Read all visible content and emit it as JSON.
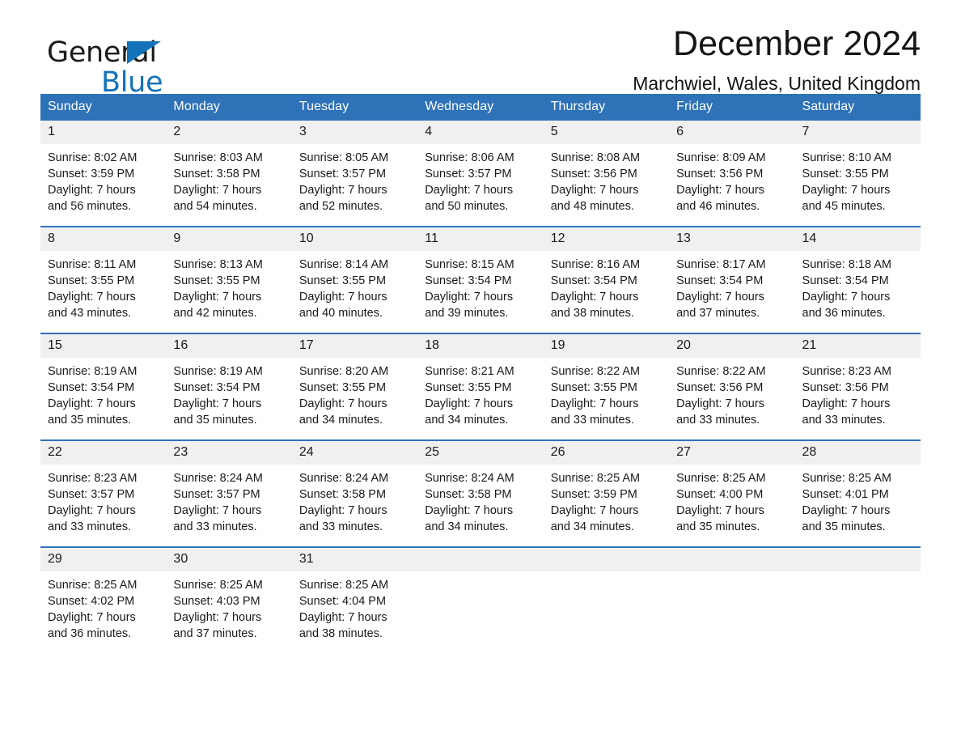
{
  "brand": {
    "name_part1": "General",
    "name_part2": "Blue",
    "flag_icon": "triangle-flag-icon",
    "accent_color": "#1372ba"
  },
  "header": {
    "title": "December 2024",
    "subtitle": "Marchwiel, Wales, United Kingdom"
  },
  "theme": {
    "header_blue": "#2e72b8",
    "daynum_band": "#f0f0f0",
    "text": "#1a1a1a"
  },
  "weekday_headers": [
    "Sunday",
    "Monday",
    "Tuesday",
    "Wednesday",
    "Thursday",
    "Friday",
    "Saturday"
  ],
  "weeks": [
    {
      "days": [
        {
          "num": "1",
          "sunrise": "Sunrise: 8:02 AM",
          "sunset": "Sunset: 3:59 PM",
          "daylight_line1": "Daylight: 7 hours",
          "daylight_line2": "and 56 minutes."
        },
        {
          "num": "2",
          "sunrise": "Sunrise: 8:03 AM",
          "sunset": "Sunset: 3:58 PM",
          "daylight_line1": "Daylight: 7 hours",
          "daylight_line2": "and 54 minutes."
        },
        {
          "num": "3",
          "sunrise": "Sunrise: 8:05 AM",
          "sunset": "Sunset: 3:57 PM",
          "daylight_line1": "Daylight: 7 hours",
          "daylight_line2": "and 52 minutes."
        },
        {
          "num": "4",
          "sunrise": "Sunrise: 8:06 AM",
          "sunset": "Sunset: 3:57 PM",
          "daylight_line1": "Daylight: 7 hours",
          "daylight_line2": "and 50 minutes."
        },
        {
          "num": "5",
          "sunrise": "Sunrise: 8:08 AM",
          "sunset": "Sunset: 3:56 PM",
          "daylight_line1": "Daylight: 7 hours",
          "daylight_line2": "and 48 minutes."
        },
        {
          "num": "6",
          "sunrise": "Sunrise: 8:09 AM",
          "sunset": "Sunset: 3:56 PM",
          "daylight_line1": "Daylight: 7 hours",
          "daylight_line2": "and 46 minutes."
        },
        {
          "num": "7",
          "sunrise": "Sunrise: 8:10 AM",
          "sunset": "Sunset: 3:55 PM",
          "daylight_line1": "Daylight: 7 hours",
          "daylight_line2": "and 45 minutes."
        }
      ]
    },
    {
      "days": [
        {
          "num": "8",
          "sunrise": "Sunrise: 8:11 AM",
          "sunset": "Sunset: 3:55 PM",
          "daylight_line1": "Daylight: 7 hours",
          "daylight_line2": "and 43 minutes."
        },
        {
          "num": "9",
          "sunrise": "Sunrise: 8:13 AM",
          "sunset": "Sunset: 3:55 PM",
          "daylight_line1": "Daylight: 7 hours",
          "daylight_line2": "and 42 minutes."
        },
        {
          "num": "10",
          "sunrise": "Sunrise: 8:14 AM",
          "sunset": "Sunset: 3:55 PM",
          "daylight_line1": "Daylight: 7 hours",
          "daylight_line2": "and 40 minutes."
        },
        {
          "num": "11",
          "sunrise": "Sunrise: 8:15 AM",
          "sunset": "Sunset: 3:54 PM",
          "daylight_line1": "Daylight: 7 hours",
          "daylight_line2": "and 39 minutes."
        },
        {
          "num": "12",
          "sunrise": "Sunrise: 8:16 AM",
          "sunset": "Sunset: 3:54 PM",
          "daylight_line1": "Daylight: 7 hours",
          "daylight_line2": "and 38 minutes."
        },
        {
          "num": "13",
          "sunrise": "Sunrise: 8:17 AM",
          "sunset": "Sunset: 3:54 PM",
          "daylight_line1": "Daylight: 7 hours",
          "daylight_line2": "and 37 minutes."
        },
        {
          "num": "14",
          "sunrise": "Sunrise: 8:18 AM",
          "sunset": "Sunset: 3:54 PM",
          "daylight_line1": "Daylight: 7 hours",
          "daylight_line2": "and 36 minutes."
        }
      ]
    },
    {
      "days": [
        {
          "num": "15",
          "sunrise": "Sunrise: 8:19 AM",
          "sunset": "Sunset: 3:54 PM",
          "daylight_line1": "Daylight: 7 hours",
          "daylight_line2": "and 35 minutes."
        },
        {
          "num": "16",
          "sunrise": "Sunrise: 8:19 AM",
          "sunset": "Sunset: 3:54 PM",
          "daylight_line1": "Daylight: 7 hours",
          "daylight_line2": "and 35 minutes."
        },
        {
          "num": "17",
          "sunrise": "Sunrise: 8:20 AM",
          "sunset": "Sunset: 3:55 PM",
          "daylight_line1": "Daylight: 7 hours",
          "daylight_line2": "and 34 minutes."
        },
        {
          "num": "18",
          "sunrise": "Sunrise: 8:21 AM",
          "sunset": "Sunset: 3:55 PM",
          "daylight_line1": "Daylight: 7 hours",
          "daylight_line2": "and 34 minutes."
        },
        {
          "num": "19",
          "sunrise": "Sunrise: 8:22 AM",
          "sunset": "Sunset: 3:55 PM",
          "daylight_line1": "Daylight: 7 hours",
          "daylight_line2": "and 33 minutes."
        },
        {
          "num": "20",
          "sunrise": "Sunrise: 8:22 AM",
          "sunset": "Sunset: 3:56 PM",
          "daylight_line1": "Daylight: 7 hours",
          "daylight_line2": "and 33 minutes."
        },
        {
          "num": "21",
          "sunrise": "Sunrise: 8:23 AM",
          "sunset": "Sunset: 3:56 PM",
          "daylight_line1": "Daylight: 7 hours",
          "daylight_line2": "and 33 minutes."
        }
      ]
    },
    {
      "days": [
        {
          "num": "22",
          "sunrise": "Sunrise: 8:23 AM",
          "sunset": "Sunset: 3:57 PM",
          "daylight_line1": "Daylight: 7 hours",
          "daylight_line2": "and 33 minutes."
        },
        {
          "num": "23",
          "sunrise": "Sunrise: 8:24 AM",
          "sunset": "Sunset: 3:57 PM",
          "daylight_line1": "Daylight: 7 hours",
          "daylight_line2": "and 33 minutes."
        },
        {
          "num": "24",
          "sunrise": "Sunrise: 8:24 AM",
          "sunset": "Sunset: 3:58 PM",
          "daylight_line1": "Daylight: 7 hours",
          "daylight_line2": "and 33 minutes."
        },
        {
          "num": "25",
          "sunrise": "Sunrise: 8:24 AM",
          "sunset": "Sunset: 3:58 PM",
          "daylight_line1": "Daylight: 7 hours",
          "daylight_line2": "and 34 minutes."
        },
        {
          "num": "26",
          "sunrise": "Sunrise: 8:25 AM",
          "sunset": "Sunset: 3:59 PM",
          "daylight_line1": "Daylight: 7 hours",
          "daylight_line2": "and 34 minutes."
        },
        {
          "num": "27",
          "sunrise": "Sunrise: 8:25 AM",
          "sunset": "Sunset: 4:00 PM",
          "daylight_line1": "Daylight: 7 hours",
          "daylight_line2": "and 35 minutes."
        },
        {
          "num": "28",
          "sunrise": "Sunrise: 8:25 AM",
          "sunset": "Sunset: 4:01 PM",
          "daylight_line1": "Daylight: 7 hours",
          "daylight_line2": "and 35 minutes."
        }
      ]
    },
    {
      "days": [
        {
          "num": "29",
          "sunrise": "Sunrise: 8:25 AM",
          "sunset": "Sunset: 4:02 PM",
          "daylight_line1": "Daylight: 7 hours",
          "daylight_line2": "and 36 minutes."
        },
        {
          "num": "30",
          "sunrise": "Sunrise: 8:25 AM",
          "sunset": "Sunset: 4:03 PM",
          "daylight_line1": "Daylight: 7 hours",
          "daylight_line2": "and 37 minutes."
        },
        {
          "num": "31",
          "sunrise": "Sunrise: 8:25 AM",
          "sunset": "Sunset: 4:04 PM",
          "daylight_line1": "Daylight: 7 hours",
          "daylight_line2": "and 38 minutes."
        },
        {
          "num": "",
          "sunrise": "",
          "sunset": "",
          "daylight_line1": "",
          "daylight_line2": "",
          "blank": true
        },
        {
          "num": "",
          "sunrise": "",
          "sunset": "",
          "daylight_line1": "",
          "daylight_line2": "",
          "blank": true
        },
        {
          "num": "",
          "sunrise": "",
          "sunset": "",
          "daylight_line1": "",
          "daylight_line2": "",
          "blank": true
        },
        {
          "num": "",
          "sunrise": "",
          "sunset": "",
          "daylight_line1": "",
          "daylight_line2": "",
          "blank": true
        }
      ]
    }
  ]
}
